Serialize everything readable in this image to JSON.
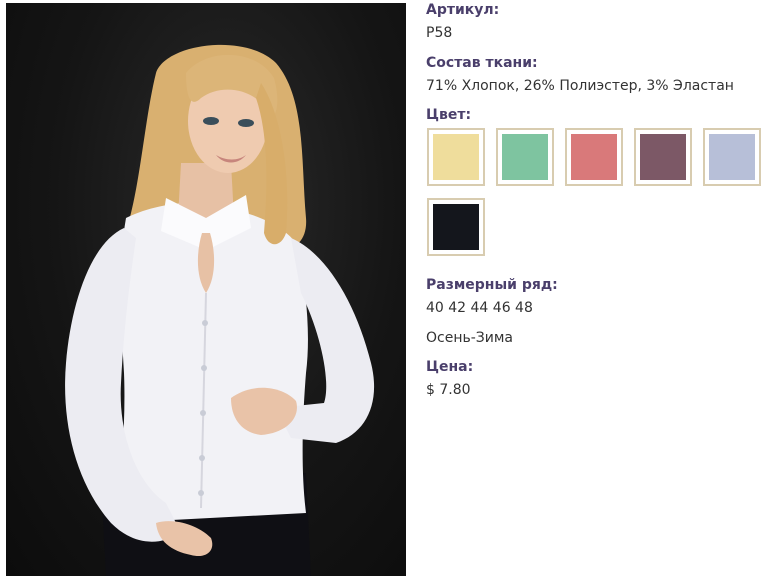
{
  "product": {
    "sku_label": "Артикул:",
    "sku_value": "P58",
    "fabric_label": "Состав ткани:",
    "fabric_value": "71% Хлопок, 26% Полиэстер, 3% Эластан",
    "color_label": "Цвет:",
    "colors": [
      {
        "name": "yellow-swatch",
        "hex": "#efdd9c"
      },
      {
        "name": "mint-swatch",
        "hex": "#7ec4a0"
      },
      {
        "name": "pink-swatch",
        "hex": "#d9797a"
      },
      {
        "name": "plum-swatch",
        "hex": "#7c5866"
      },
      {
        "name": "lavender-swatch",
        "hex": "#b7bfd8"
      },
      {
        "name": "black-swatch",
        "hex": "#14161c"
      }
    ],
    "size_label": "Размерный ряд:",
    "size_value": "40 42 44 46 48",
    "season_value": "Осень-Зима",
    "price_label": "Цена:",
    "price_value": "$ 7.80"
  },
  "theme": {
    "label_color": "#4a3f6b",
    "swatch_border": "#d8ccb0"
  }
}
